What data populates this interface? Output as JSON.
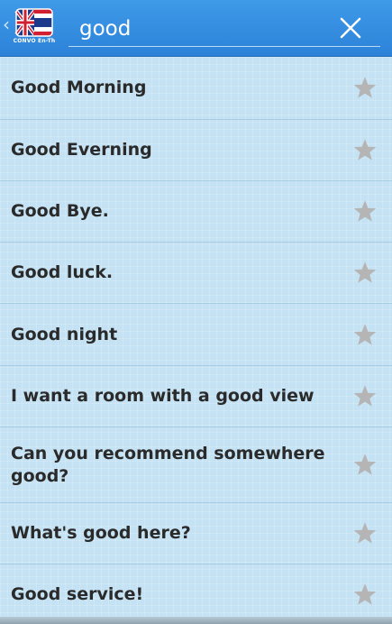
{
  "header": {
    "logo_caption": "CONVO En-Th",
    "search_value": "good"
  },
  "colors": {
    "header_blue": "#2c82d8",
    "list_bg": "#c4e2f3",
    "star_grey": "#b5b5b5"
  },
  "results": [
    {
      "text": "Good Morning"
    },
    {
      "text": "Good Everning"
    },
    {
      "text": "Good Bye."
    },
    {
      "text": "Good luck."
    },
    {
      "text": "Good night"
    },
    {
      "text": "I want a room with a good view"
    },
    {
      "text": "Can you recommend somewhere good?"
    },
    {
      "text": "What's good here?"
    },
    {
      "text": "Good service!"
    }
  ]
}
